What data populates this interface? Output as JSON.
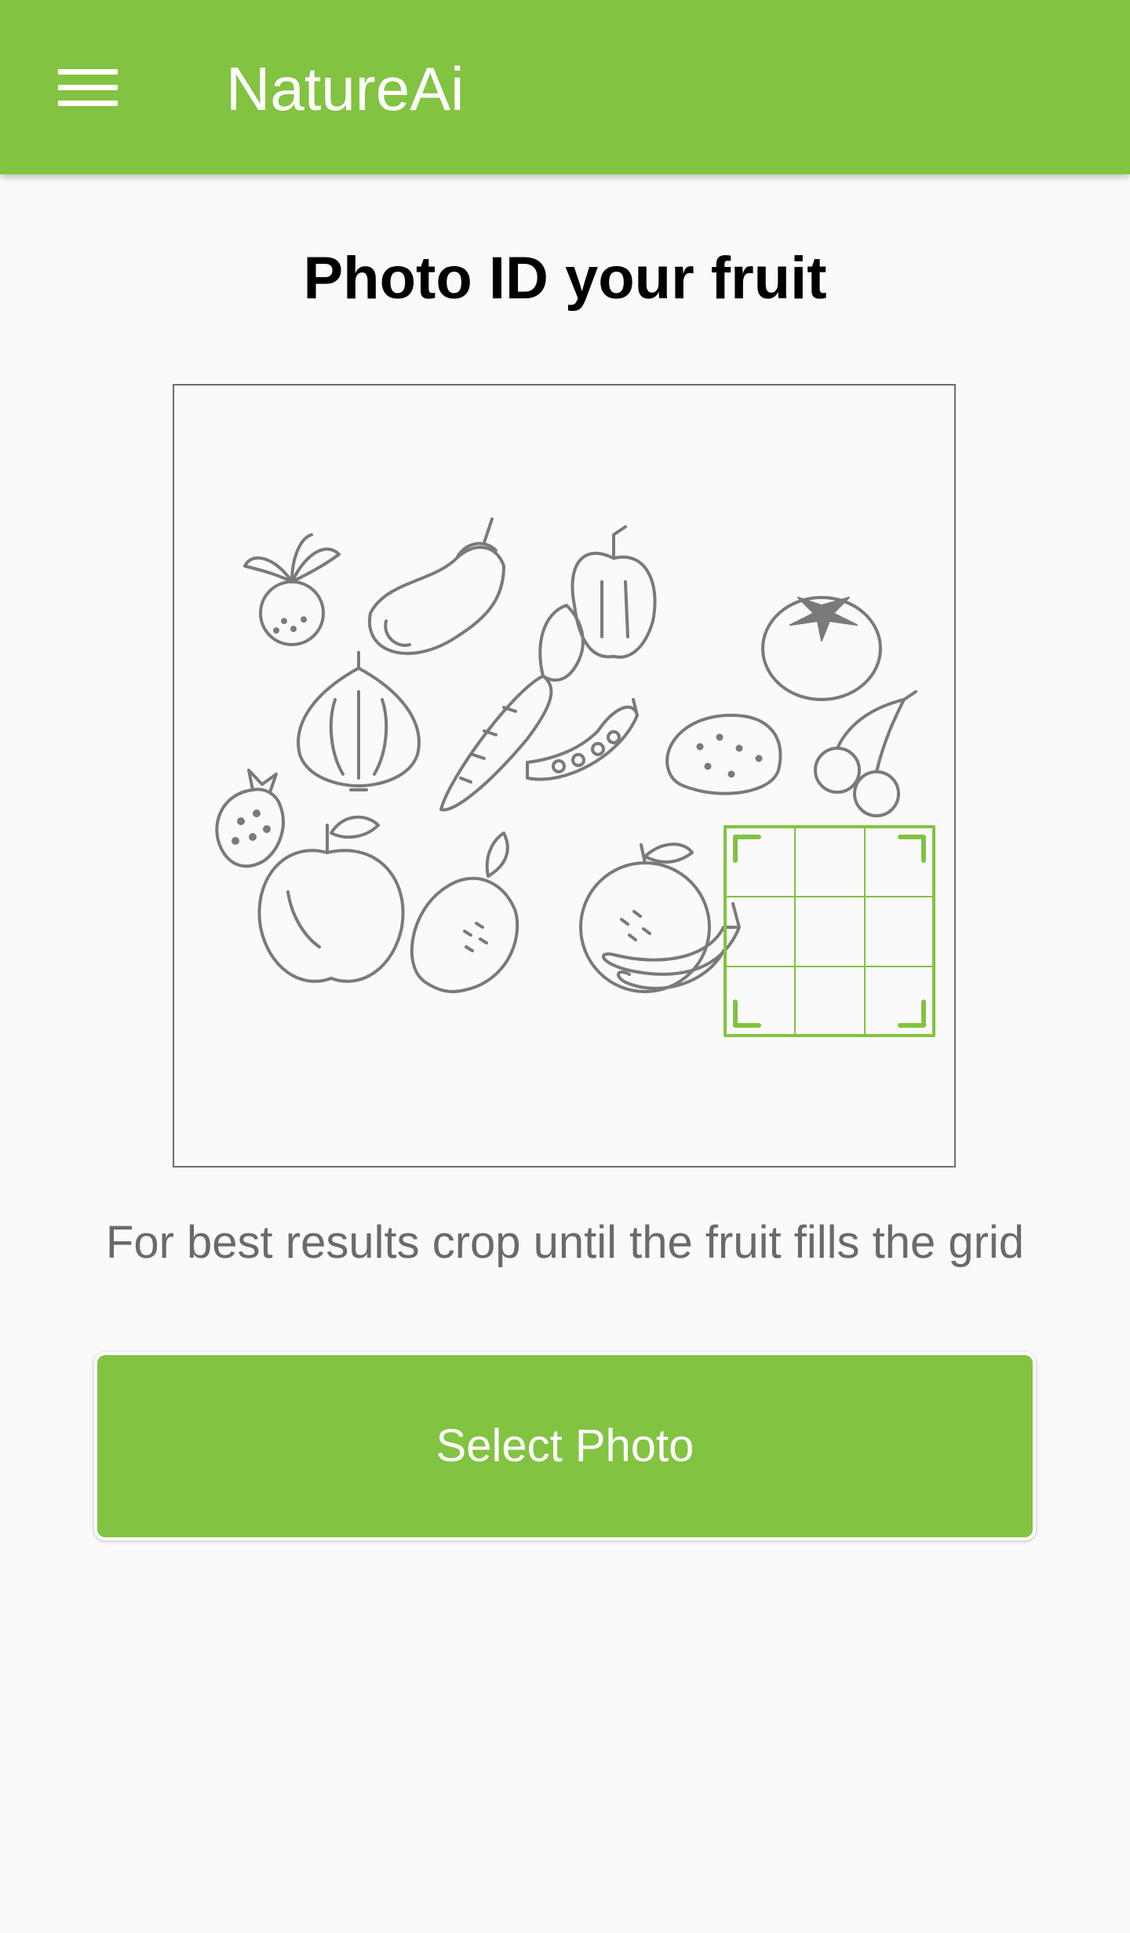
{
  "app_bar": {
    "title": "NatureAi",
    "menu_icon": "hamburger-menu-icon",
    "background_color": "#82c341"
  },
  "main": {
    "heading": "Photo ID your fruit",
    "illustration": "fruit-vegetable-grid-illustration",
    "crop_grid_color": "#82c341",
    "hint": "For best results crop until the fruit fills the grid",
    "select_button_label": "Select Photo"
  },
  "colors": {
    "accent": "#82c341",
    "background": "#fafafa",
    "hint_text": "#6a6a6a"
  }
}
